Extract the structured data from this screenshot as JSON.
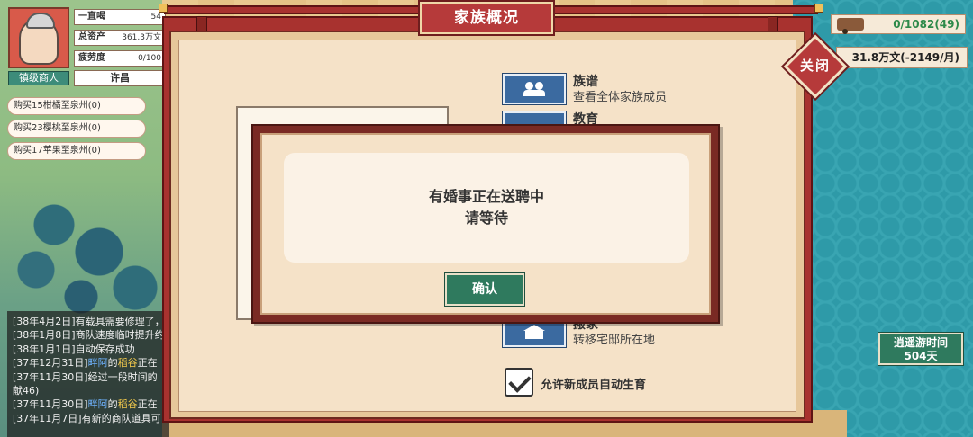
{
  "player": {
    "rank": "镇级商人",
    "city": "许昌",
    "stats": [
      {
        "label": "一直喝",
        "value": "54"
      },
      {
        "label": "总资产",
        "value": "361.3万文"
      },
      {
        "label": "疲劳度",
        "value": "0/100"
      }
    ]
  },
  "tasks": [
    "购买15柑橘至泉州(0)",
    "购买23樱桃至泉州(0)",
    "购买17苹果至泉州(0)"
  ],
  "log": [
    {
      "text": "[38年4月2日]有载具需要修理了，"
    },
    {
      "text": "[38年1月8日]商队速度临时提升约"
    },
    {
      "text": "[38年1月1日]自动保存成功"
    },
    {
      "pre": "[37年12月31日]",
      "name": "畔阿",
      "mid": "的",
      "item": "稻谷",
      "post": "正在"
    },
    {
      "text": "[37年11月30日]经过一段时间的"
    },
    {
      "text": "献46)"
    },
    {
      "pre": "[37年11月30日]",
      "name": "畔阿",
      "mid": "的",
      "item": "稻谷",
      "post": "正在"
    },
    {
      "text": "[37年11月7日]有新的商队道具可"
    }
  ],
  "top_right": {
    "cargo": "0/1082(49)",
    "money": "31.8万文(-2149/月)",
    "close_label": "关闭"
  },
  "panel": {
    "title": "家族概况",
    "menu": [
      {
        "title": "族谱",
        "desc": "查看全体家族成员",
        "icon": "family-tree-icon"
      },
      {
        "title": "教育",
        "desc": "",
        "icon": "education-icon"
      },
      {
        "title": "搬家",
        "desc": "转移宅邸所在地",
        "icon": "house-icon"
      }
    ],
    "auto_birth_label": "允许新成员自动生育"
  },
  "modal": {
    "line1": "有婚事正在送聘中",
    "line2": "请等待",
    "confirm": "确认"
  },
  "travel": {
    "label": "逍遥游时间",
    "days": "504天"
  },
  "colors": {
    "panel_red": "#a8322f",
    "button_green": "#2f7a5e",
    "parchment": "#f5e2c8",
    "menu_blue": "#3b6aa0"
  }
}
